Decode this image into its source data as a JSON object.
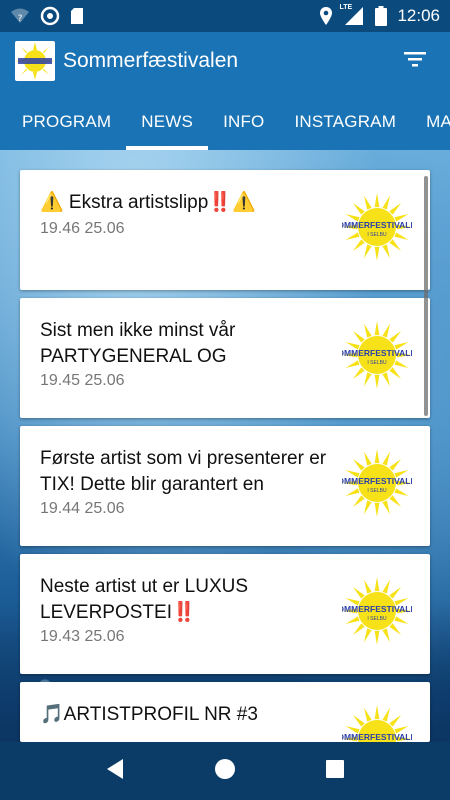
{
  "status_bar": {
    "time": "12:06",
    "network": "LTE",
    "icons": [
      "wifi-question-icon",
      "sync-circle-icon",
      "sd-card-icon",
      "location-icon",
      "signal-icon",
      "battery-icon"
    ]
  },
  "app_bar": {
    "title": "Sommerfæstivalen",
    "logo_icon": "festival-sun-logo",
    "filter_icon": "filter-icon"
  },
  "tabs": [
    {
      "label": "PROGRAM",
      "active": false
    },
    {
      "label": "NEWS",
      "active": true
    },
    {
      "label": "INFO",
      "active": false
    },
    {
      "label": "INSTAGRAM",
      "active": false
    },
    {
      "label": "MAP",
      "active": false
    }
  ],
  "news": [
    {
      "title": "⚠️ Ekstra artistslipp‼️⚠️",
      "time": "19.46 25.06"
    },
    {
      "title": "Sist men ikke minst vår PARTYGENERAL OG",
      "time": "19.45 25.06"
    },
    {
      "title": "Første artist som vi presenterer er TIX! Dette blir garantert en",
      "time": "19.44 25.06"
    },
    {
      "title": "Neste artist ut er LUXUS LEVERPOSTEI‼️",
      "time": "19.43 25.06"
    },
    {
      "title": "🎵ARTISTPROFIL NR #3",
      "time": ""
    }
  ],
  "logo_text": {
    "main": "SOMMERFESTIVALEN",
    "sub": "I SELBU"
  },
  "colors": {
    "primary": "#1a73b5",
    "status_bar": "#0a4a7d",
    "nav_bar": "#0b3c67",
    "sun_yellow": "#f7e21a",
    "logo_blue": "#2a3fa8"
  },
  "nav_bar": {
    "icons": [
      "back-icon",
      "home-icon",
      "recents-icon"
    ]
  }
}
